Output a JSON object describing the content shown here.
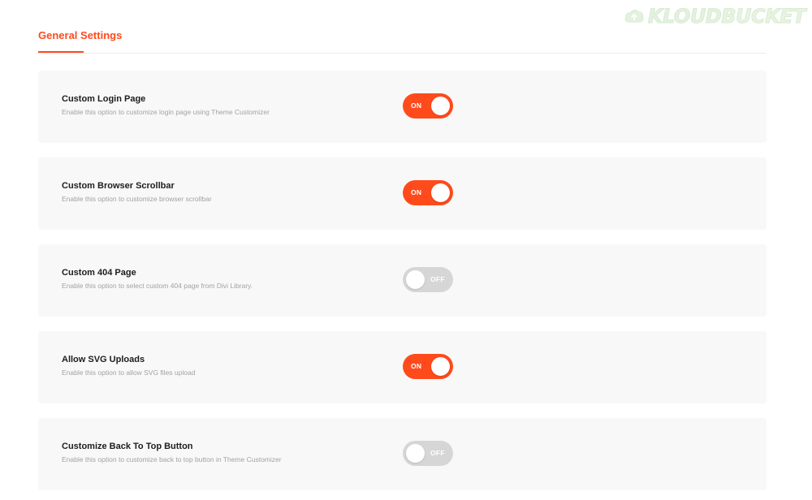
{
  "watermark": {
    "text_a": "KLOUD",
    "text_b": "BUCKET",
    "icon": "cloud-upload-icon"
  },
  "tabs": {
    "active_label": "General Settings",
    "accent_color": "#ff4a1c"
  },
  "settings": [
    {
      "title": "Custom Login Page",
      "description": "Enable this option to customize login page using Theme Customizer",
      "state": "on",
      "toggle_label": "ON"
    },
    {
      "title": "Custom Browser Scrollbar",
      "description": "Enable this option to customize browser scrollbar",
      "state": "on",
      "toggle_label": "ON"
    },
    {
      "title": "Custom 404 Page",
      "description": "Enable this option to select custom 404 page from Divi Library.",
      "state": "off",
      "toggle_label": "OFF"
    },
    {
      "title": "Allow SVG Uploads",
      "description": "Enable this option to allow SVG files upload",
      "state": "on",
      "toggle_label": "ON"
    },
    {
      "title": "Customize Back To Top Button",
      "description": "Enable this option to customize back to top button in Theme Customizer",
      "state": "off",
      "toggle_label": "OFF"
    }
  ],
  "colors": {
    "toggle_on": "#ff4a1c",
    "toggle_off": "#d6d6d6",
    "card_bg": "#f8f8f8"
  }
}
